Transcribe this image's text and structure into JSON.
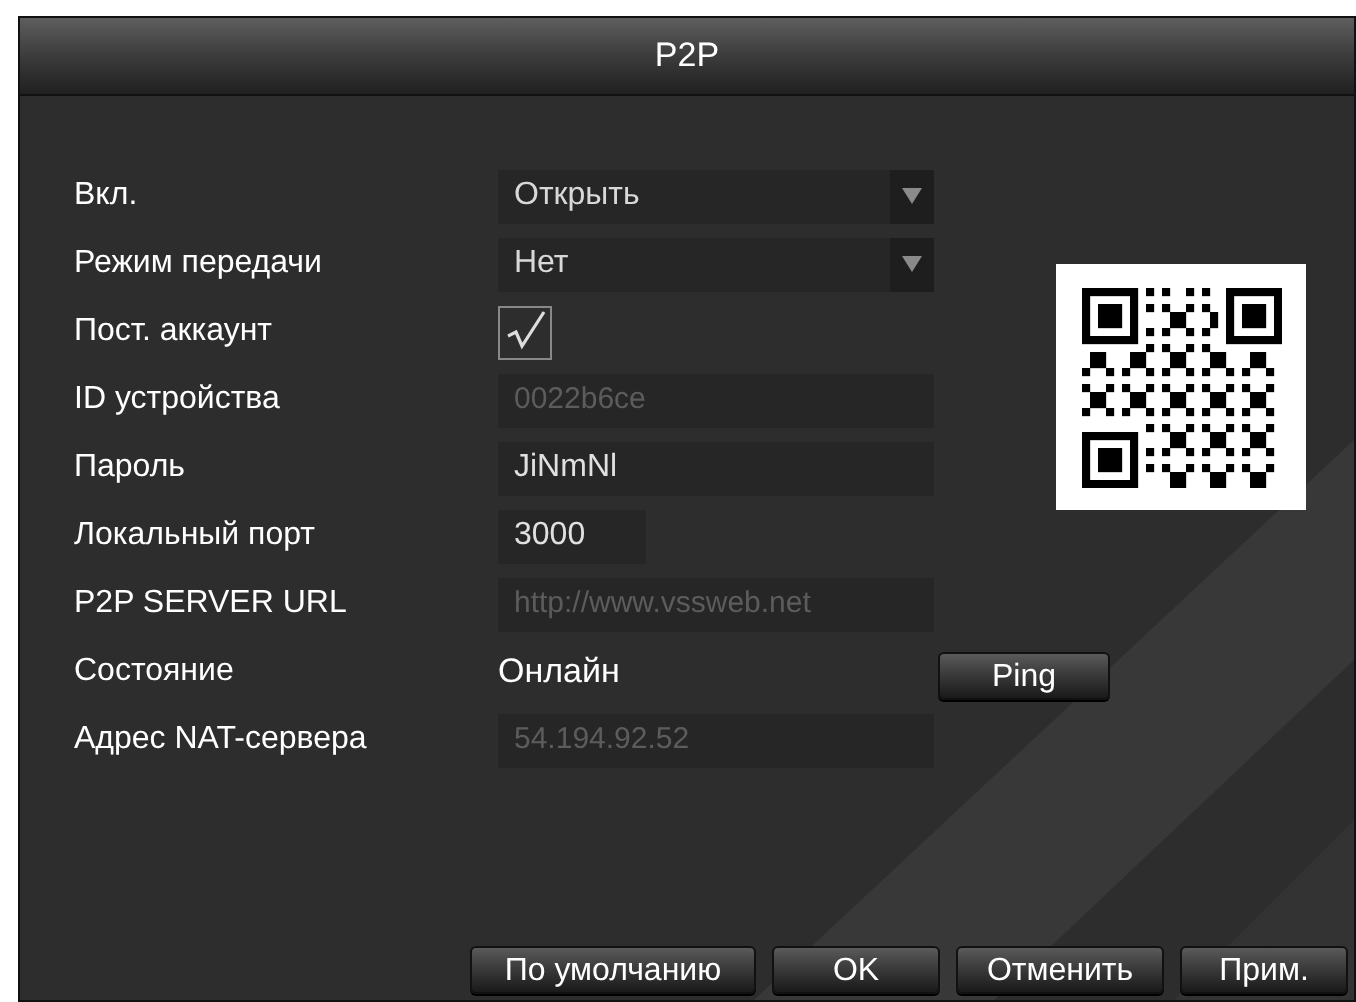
{
  "window": {
    "title": "P2P"
  },
  "rows": [
    {
      "kind": "select",
      "label": "Вкл.",
      "value": "Открыть"
    },
    {
      "kind": "select",
      "label": "Режим передачи",
      "value": "Нет"
    },
    {
      "kind": "checkbox",
      "label": "Пост. аккаунт",
      "checked": true
    },
    {
      "kind": "field",
      "label": "ID устройства",
      "value": "0022b6ce",
      "disabled": true
    },
    {
      "kind": "field",
      "label": "Пароль",
      "value": "JiNmNl",
      "disabled": false
    },
    {
      "kind": "short",
      "label": "Локальный порт",
      "value": "3000",
      "disabled": false
    },
    {
      "kind": "field",
      "label": "P2P SERVER URL",
      "value": "http://www.vssweb.net",
      "disabled": true
    },
    {
      "kind": "status",
      "label": "Состояние",
      "value": "Онлайн",
      "button": "Ping"
    },
    {
      "kind": "field",
      "label": "Адрес NAT-сервера",
      "value": "54.194.92.52",
      "disabled": true
    }
  ],
  "buttons": [
    "По умолчанию",
    "OK",
    "Отменить",
    "Прим."
  ]
}
